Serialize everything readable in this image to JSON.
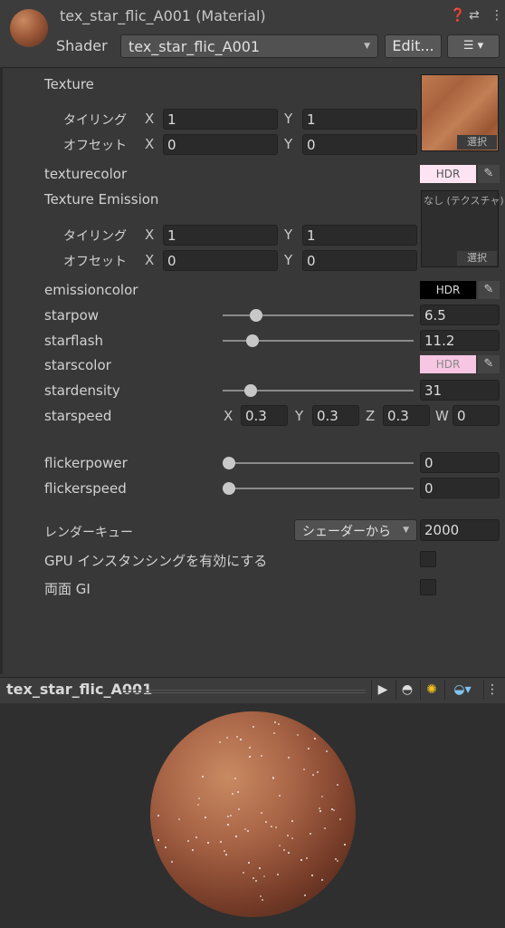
{
  "header": {
    "title": "tex_star_flic_A001 (Material)",
    "shader_label": "Shader",
    "shader_value": "tex_star_flic_A001",
    "edit_label": "Edit...",
    "help_icon": "help-icon",
    "settings_icon": "sliders-icon",
    "more_icon": "kebab-icon",
    "list_icon": "list-menu-icon"
  },
  "texture": {
    "label": "Texture",
    "tiling_label": "タイリング",
    "offset_label": "オフセット",
    "tiling_x": "1",
    "tiling_y": "1",
    "offset_x": "0",
    "offset_y": "0",
    "select_label": "選択"
  },
  "axes": {
    "x": "X",
    "y": "Y",
    "z": "Z",
    "w": "W"
  },
  "texturecolor": {
    "label": "texturecolor",
    "hdr": "HDR",
    "color": "#fde4f2"
  },
  "emission": {
    "label": "Texture Emission",
    "none_label": "なし (テクスチャ)",
    "select_label": "選択",
    "tiling_x": "1",
    "tiling_y": "1",
    "offset_x": "0",
    "offset_y": "0"
  },
  "emissioncolor": {
    "label": "emissioncolor",
    "hdr": "HDR",
    "color": "#000000"
  },
  "starpow": {
    "label": "starpow",
    "value": "6.5",
    "fraction": 0.15
  },
  "starflash": {
    "label": "starflash",
    "value": "11.2",
    "fraction": 0.13
  },
  "starscolor": {
    "label": "starscolor",
    "hdr": "HDR",
    "color": "#f6c6e2"
  },
  "stardensity": {
    "label": "stardensity",
    "value": "31",
    "fraction": 0.12
  },
  "starspeed": {
    "label": "starspeed",
    "x": "0.3",
    "y": "0.3",
    "z": "0.3",
    "w": "0"
  },
  "flickerpower": {
    "label": "flickerpower",
    "value": "0",
    "fraction": 0
  },
  "flickerspeed": {
    "label": "flickerspeed",
    "value": "0",
    "fraction": 0
  },
  "render_queue": {
    "label": "レンダーキュー",
    "mode": "シェーダーから",
    "value": "2000"
  },
  "gpu_instancing": {
    "label": "GPU インスタンシングを有効にする",
    "checked": false
  },
  "double_sided_gi": {
    "label": "両面 GI",
    "checked": false
  },
  "preview": {
    "title": "tex_star_flic_A001"
  }
}
